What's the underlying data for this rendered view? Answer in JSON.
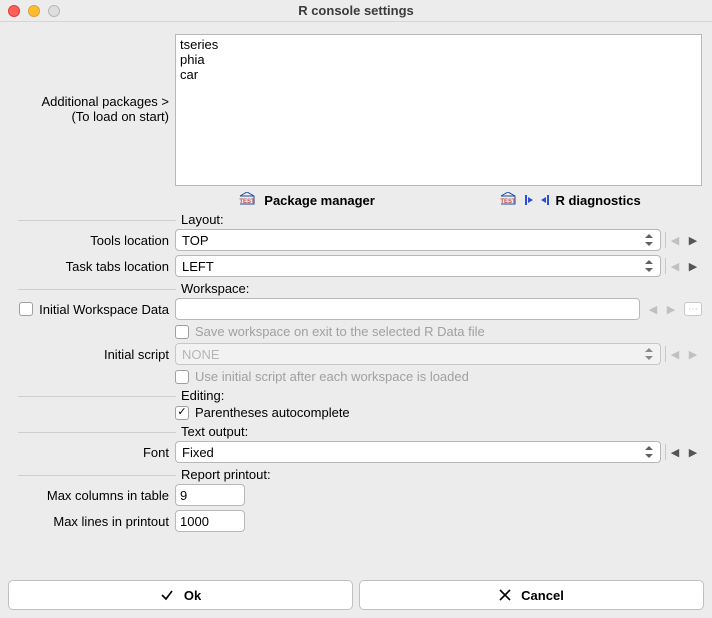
{
  "window": {
    "title": "R console settings"
  },
  "packages": {
    "label_top": "Additional packages >",
    "label_bottom": "(To load on start)",
    "value": "tseries\nphia\ncar"
  },
  "links": {
    "package_manager": "Package manager",
    "r_diagnostics": "R diagnostics"
  },
  "sections": {
    "layout": "Layout:",
    "workspace": "Workspace:",
    "editing": "Editing:",
    "text_output": "Text output:",
    "report_printout": "Report printout:"
  },
  "layout": {
    "tools_label": "Tools location",
    "tools_value": "TOP",
    "tabs_label": "Task tabs location",
    "tabs_value": "LEFT"
  },
  "workspace": {
    "data_label": "Initial Workspace Data",
    "data_value": "",
    "save_label": "Save workspace on exit to the selected R Data file",
    "script_label": "Initial script",
    "script_value": "NONE",
    "use_script_label": "Use initial script after each workspace is loaded"
  },
  "editing": {
    "paren_label": "Parentheses autocomplete"
  },
  "text_output": {
    "font_label": "Font",
    "font_value": "Fixed"
  },
  "report": {
    "max_cols_label": "Max columns in table",
    "max_cols_value": "9",
    "max_lines_label": "Max lines in printout",
    "max_lines_value": "1000"
  },
  "buttons": {
    "ok": "Ok",
    "cancel": "Cancel"
  }
}
